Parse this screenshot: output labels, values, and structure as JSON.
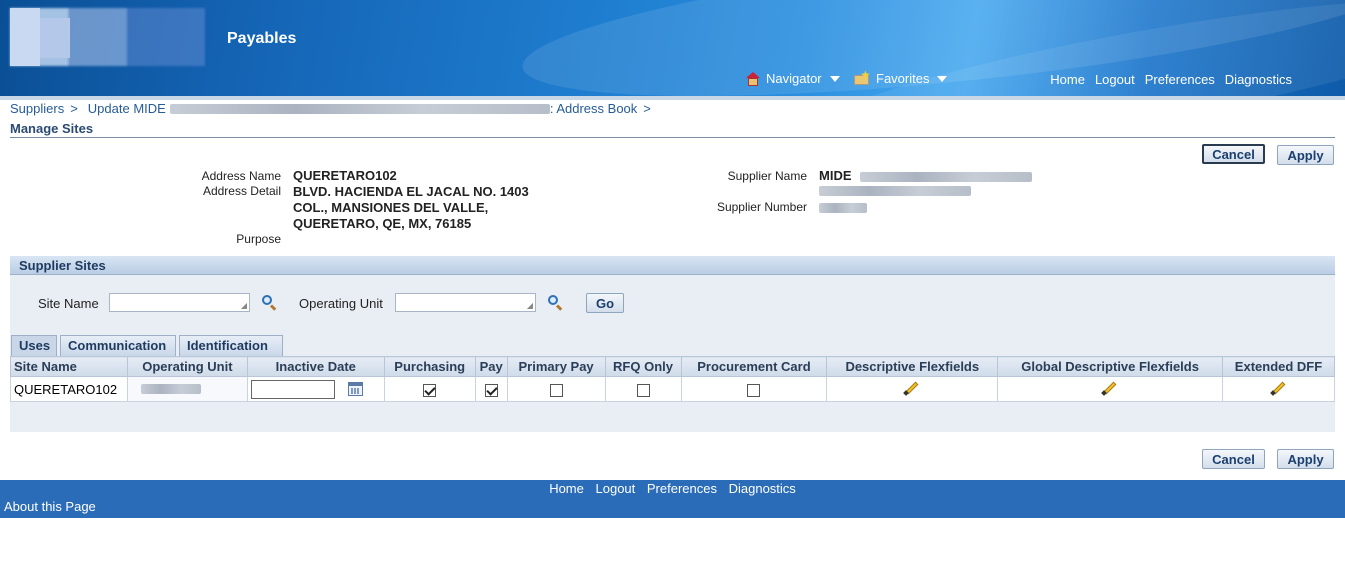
{
  "header": {
    "app_title": "Payables",
    "navigator_label": "Navigator",
    "favorites_label": "Favorites",
    "global_links": [
      "Home",
      "Logout",
      "Preferences",
      "Diagnostics"
    ]
  },
  "breadcrumb": {
    "items": [
      "Suppliers",
      "Update MIDE",
      ": Address Book"
    ],
    "separator": ">"
  },
  "page_title": "Manage Sites",
  "buttons": {
    "cancel": "Cancel",
    "apply": "Apply"
  },
  "address": {
    "name_label": "Address Name",
    "name_value": "QUERETARO102",
    "detail_label": "Address Detail",
    "detail_lines": [
      "BLVD. HACIENDA EL JACAL NO. 1403",
      "COL., MANSIONES DEL VALLE,",
      "QUERETARO, QE, MX, 76185"
    ],
    "purpose_label": "Purpose"
  },
  "supplier": {
    "name_label": "Supplier Name",
    "name_value": "MIDE",
    "number_label": "Supplier Number"
  },
  "supplier_sites": {
    "title": "Supplier Sites",
    "site_name_label": "Site Name",
    "site_name_value": "",
    "operating_unit_label": "Operating Unit",
    "operating_unit_value": "",
    "go_label": "Go",
    "tabs": [
      "Uses",
      "Communication",
      "Identification"
    ],
    "active_tab": "Uses",
    "columns": [
      "Site Name",
      "Operating Unit",
      "Inactive Date",
      "Purchasing",
      "Pay",
      "Primary Pay",
      "RFQ Only",
      "Procurement Card",
      "Descriptive Flexfields",
      "Global Descriptive Flexfields",
      "Extended DFF"
    ],
    "rows": [
      {
        "site_name": "QUERETARO102",
        "inactive_date": "",
        "purchasing": true,
        "pay": true,
        "primary_pay": false,
        "rfq_only": false,
        "procurement_card": false
      }
    ]
  },
  "footer": {
    "links": [
      "Home",
      "Logout",
      "Preferences",
      "Diagnostics"
    ],
    "about": "About this Page"
  },
  "colors": {
    "header_blue": "#1f7ed0",
    "footer_blue": "#2a6cb8",
    "link_blue": "#265c97"
  }
}
